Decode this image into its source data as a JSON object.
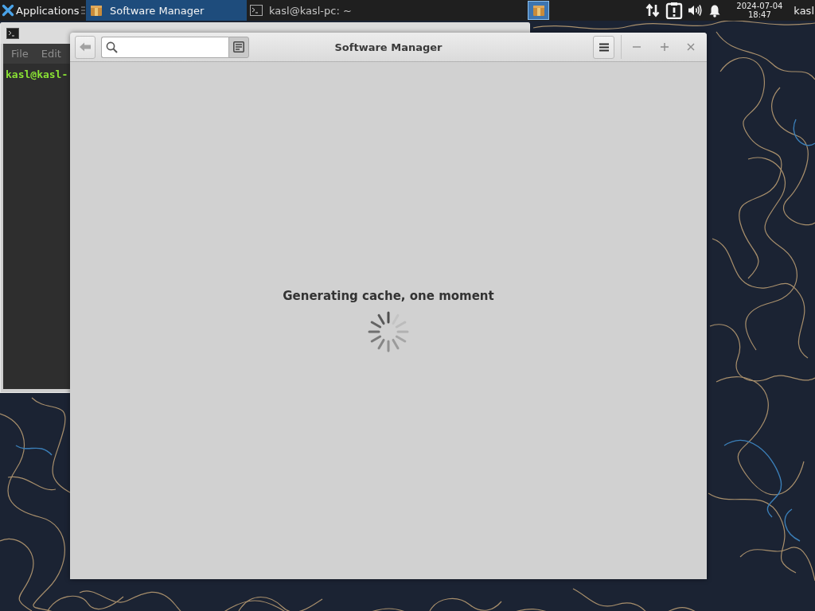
{
  "taskbar": {
    "app_menu": {
      "label": "Applications"
    },
    "tasks": [
      {
        "kind": "package",
        "label": "Software Manager",
        "selected": true
      },
      {
        "kind": "terminal",
        "label": "kasl@kasl-pc: ~",
        "selected": false
      }
    ],
    "workspaces": [
      {
        "selected": true
      }
    ],
    "clock": {
      "date": "2024-07-04",
      "time": "18:47"
    },
    "user": "kasl"
  },
  "terminal_window": {
    "menu": [
      "File",
      "Edit"
    ],
    "prompt": "kasl@kasl-"
  },
  "software_manager": {
    "title": "Software Manager",
    "status": "Generating cache, one moment"
  }
}
